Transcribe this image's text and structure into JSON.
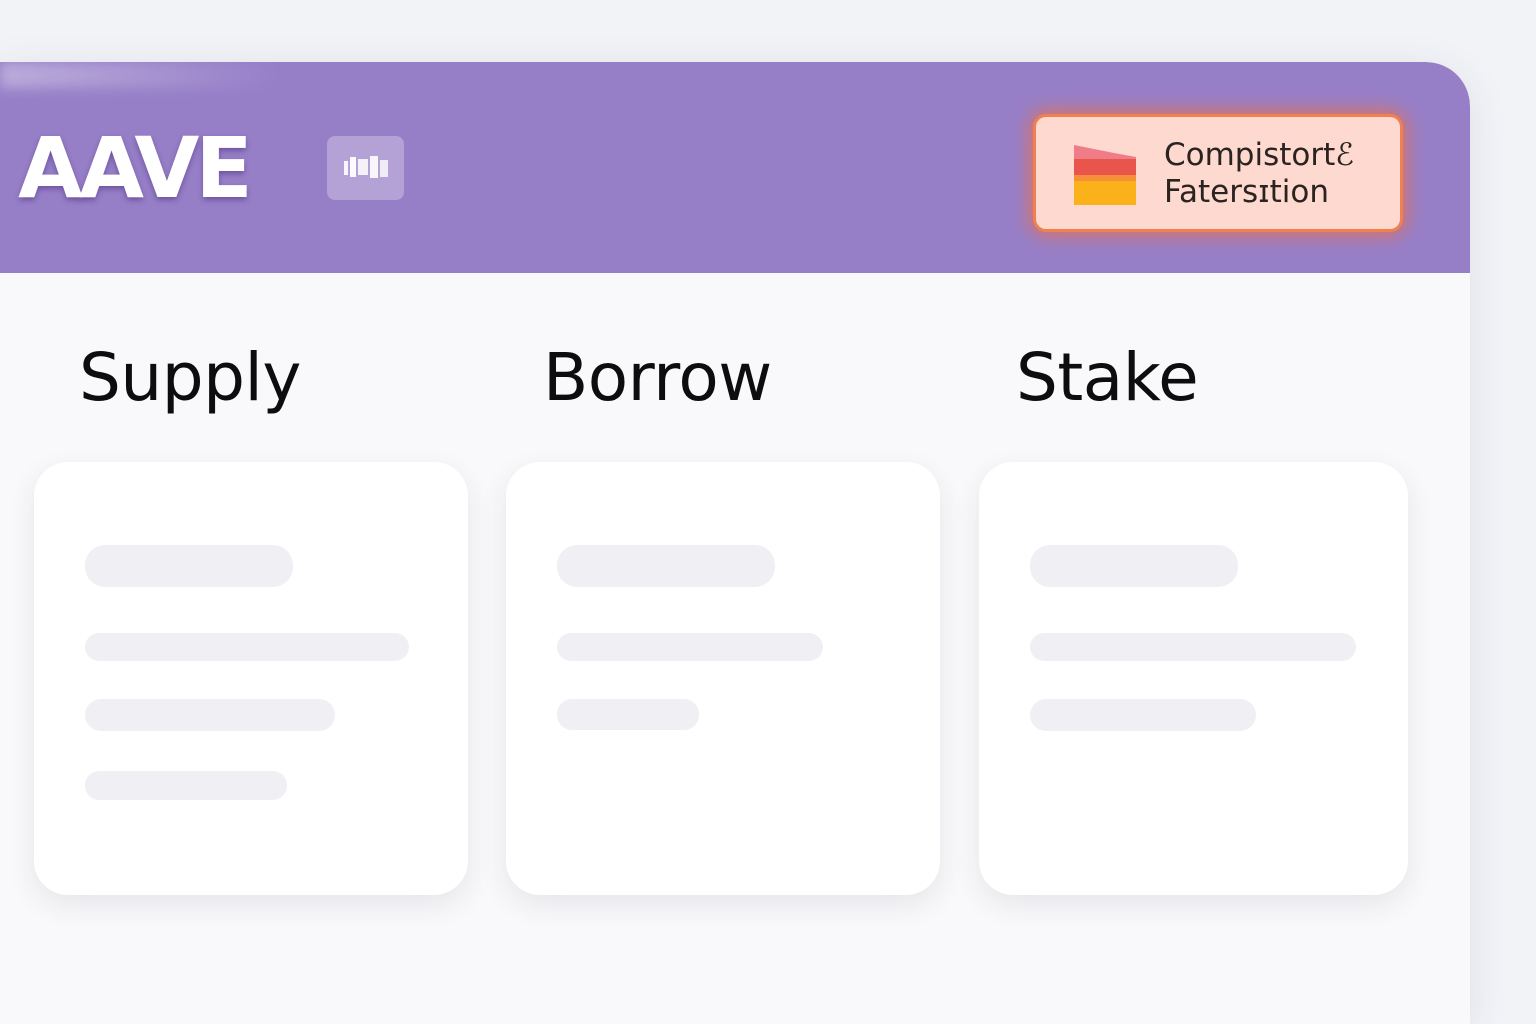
{
  "app": {
    "logo_text": "AAVE",
    "badge_icon": "exchange-badge-icon"
  },
  "header": {
    "connect_button": {
      "line1": "Compistortℰ",
      "line2": "Fatersɪtion",
      "icon": "bar-stack-icon"
    }
  },
  "colors": {
    "header_bg": "#977fc8",
    "button_bg": "#fdd9cf",
    "button_glow": "#f0814f",
    "icon_top": "#e9544b",
    "icon_bottom": "#fbb11a"
  },
  "sections": [
    {
      "title": "Supply"
    },
    {
      "title": "Borrow"
    },
    {
      "title": "Stake"
    }
  ]
}
